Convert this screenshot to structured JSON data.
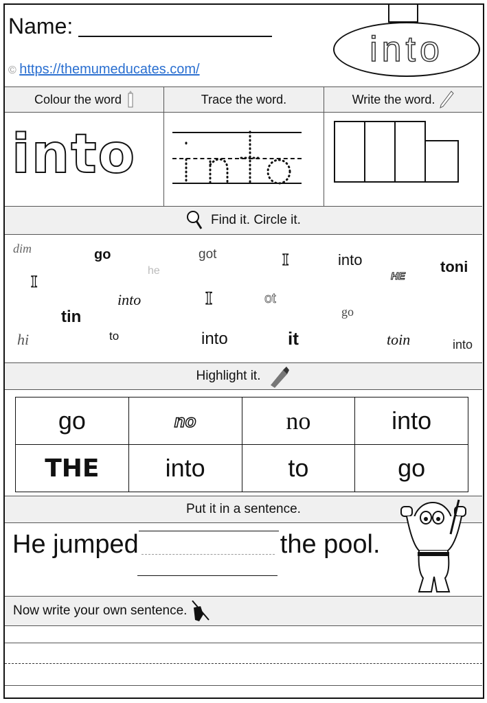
{
  "header": {
    "name_label": "Name:",
    "copyright_symbol": "©",
    "website_link": "https://themumeducates.com/",
    "target_word": "into"
  },
  "activity_headers": {
    "colour": "Colour the word",
    "trace": "Trace the word.",
    "write": "Write the word."
  },
  "colour_word": "into",
  "trace_word": "into",
  "find": {
    "title": "Find it. Circle it.",
    "words": [
      "dim",
      "go",
      "he",
      "got",
      "I",
      "into",
      "HE",
      "toni",
      "I",
      "into",
      "I",
      "ot",
      "tin",
      "go",
      "hi",
      "to",
      "into",
      "it",
      "toin",
      "into"
    ]
  },
  "highlight": {
    "title": "Highlight it.",
    "rows": [
      [
        "go",
        "no",
        "no",
        "into"
      ],
      [
        "THE",
        "into",
        "to",
        "go"
      ]
    ]
  },
  "sentence": {
    "title": "Put it in a sentence.",
    "before": "He jumped",
    "after": "the pool."
  },
  "own_sentence": {
    "title": "Now write your own sentence."
  },
  "icons": {
    "colour": "pencil-crayon-icon",
    "write": "pencil-icon",
    "find": "magnifier-icon",
    "highlight": "highlighter-icon",
    "own": "hand-pencil-icon",
    "mascot": "hippo-snorkel-mascot"
  }
}
